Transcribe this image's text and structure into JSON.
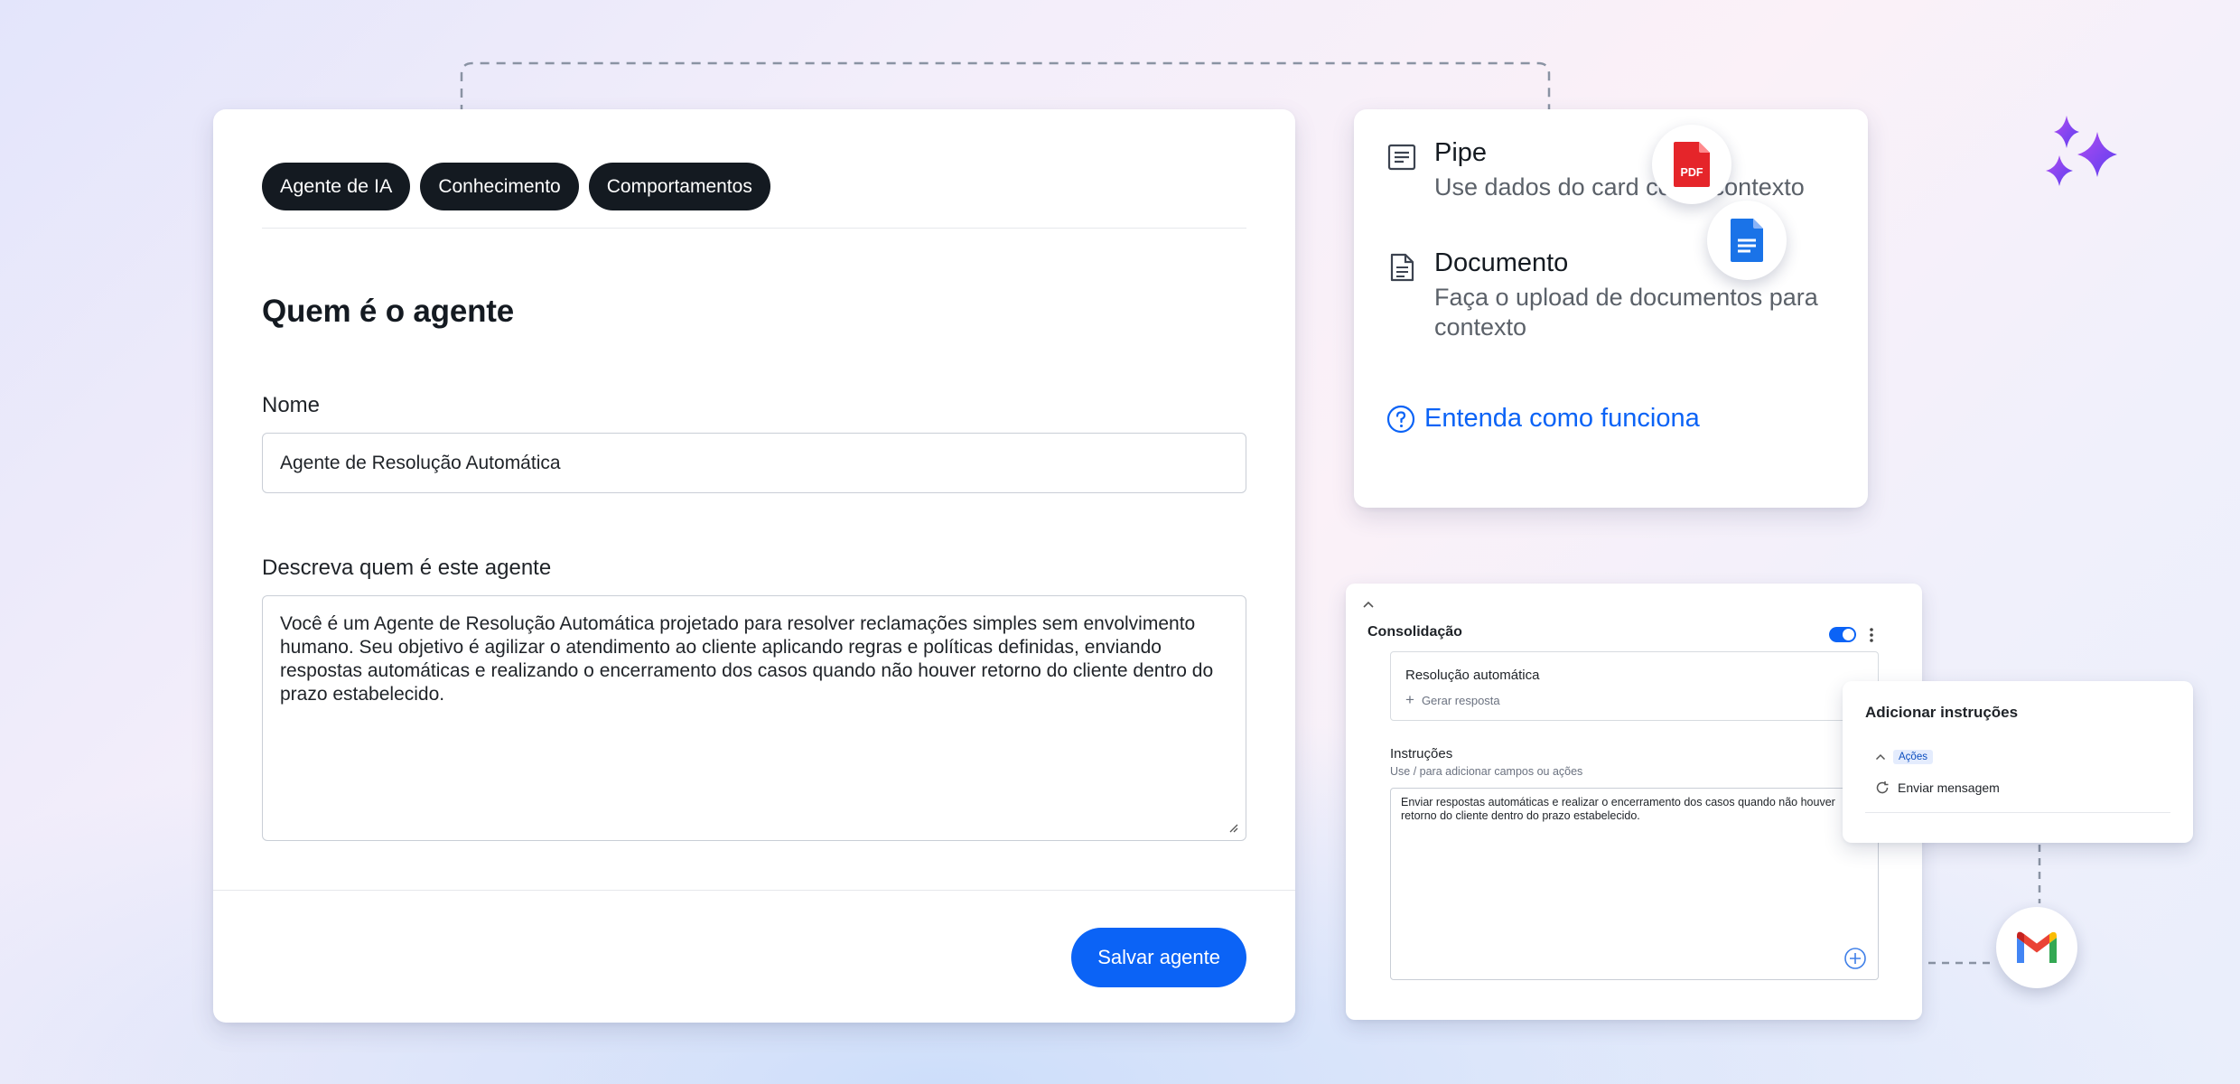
{
  "tabs": [
    "Agente de IA",
    "Conhecimento",
    "Comportamentos"
  ],
  "main": {
    "section_title": "Quem é o agente",
    "name_label": "Nome",
    "name_value": "Agente de Resolução Automática",
    "description_label": "Descreva quem é este agente",
    "description_value": "Você é um Agente de Resolução Automática projetado para resolver reclamações simples sem envolvimento humano. Seu objetivo é agilizar o atendimento ao cliente aplicando regras e políticas definidas, enviando respostas automáticas e realizando o encerramento dos casos quando não houver retorno do cliente dentro do prazo estabelecido.",
    "save_label": "Salvar agente"
  },
  "knowledge": {
    "items": [
      {
        "icon": "list-icon",
        "title": "Pipe",
        "description": "Use dados do card como contexto"
      },
      {
        "icon": "document-icon",
        "title": "Documento",
        "description": "Faça o upload de documentos para contexto"
      }
    ],
    "help_link": "Entenda como funciona",
    "pdf_badge": "PDF"
  },
  "consolidation": {
    "title": "Consolidação",
    "toggle_on": true,
    "resolution_title": "Resolução automática",
    "generate_label": "Gerar resposta",
    "instructions_title": "Instruções",
    "instructions_hint": "Use / para adicionar campos ou ações",
    "instructions_value": "Enviar respostas automáticas e realizar o encerramento dos casos quando não houver retorno do cliente dentro do prazo estabelecido."
  },
  "add_instructions": {
    "title": "Adicionar instruções",
    "group_label": "Ações",
    "action_label": "Enviar mensagem"
  },
  "colors": {
    "primary": "#0b63f6",
    "tab_bg": "#141a21",
    "pdf_red": "#e5252a",
    "doc_blue": "#1a73e8",
    "sparkle_purple": "#8b5cf6"
  }
}
